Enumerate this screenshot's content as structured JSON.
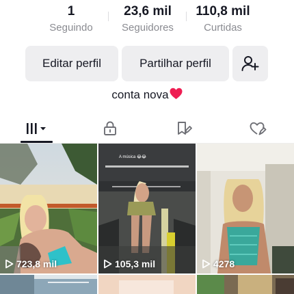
{
  "stats": [
    {
      "value": "1",
      "label": "Seguindo"
    },
    {
      "value": "23,6 mil",
      "label": "Seguidores"
    },
    {
      "value": "110,8 mil",
      "label": "Curtidas"
    }
  ],
  "actions": {
    "edit_label": "Editar perfil",
    "share_label": "Partilhar perfil",
    "add_friend_icon": "add-friend-icon"
  },
  "bio": "conta nova",
  "bio_emoji": "red-heart-icon",
  "tabs": [
    {
      "icon": "videos-grid-icon",
      "selected": true
    },
    {
      "icon": "lock-icon",
      "selected": false
    },
    {
      "icon": "favorites-icon",
      "selected": false
    },
    {
      "icon": "liked-heart-icon",
      "selected": false
    }
  ],
  "videos": [
    {
      "views": "723,8 mil",
      "overlay_text": ""
    },
    {
      "views": "105,3 mil",
      "overlay_text": "A música 😂😂"
    },
    {
      "views": "4278",
      "overlay_text": ""
    }
  ],
  "colors": {
    "text": "#161823",
    "secondary_text": "#8a8b91",
    "button_bg": "#eeeef0",
    "heart": "#ee1d52"
  }
}
